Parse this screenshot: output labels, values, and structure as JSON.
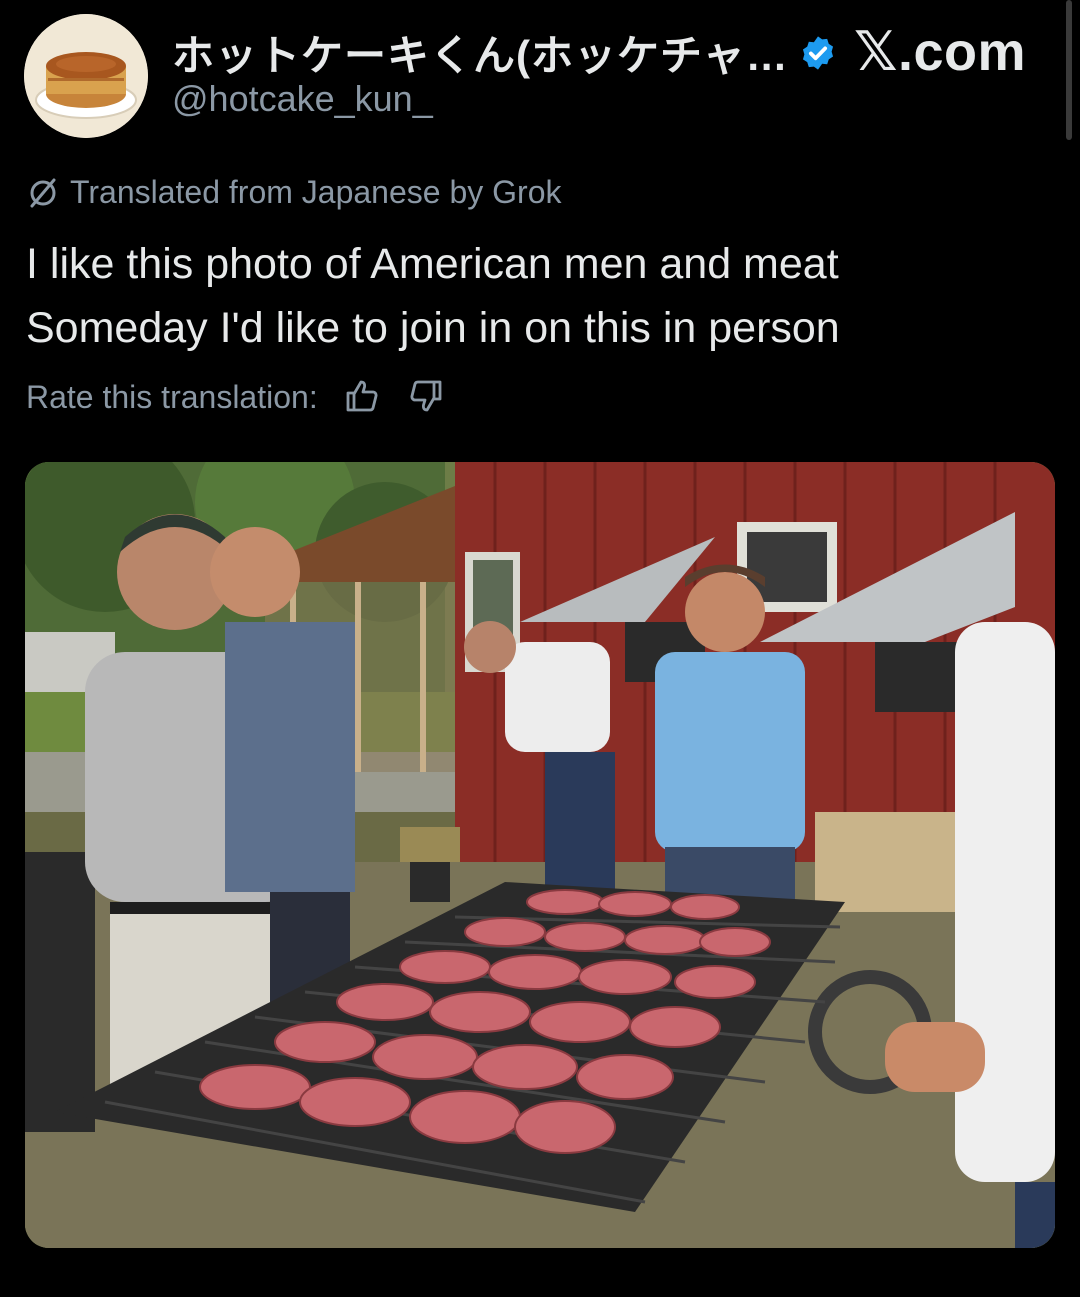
{
  "post": {
    "display_name": "ホットケーキくん(ホッケチャ…",
    "handle": "@hotcake_kun_",
    "site_label": "𝕏.com",
    "translation_note": "Translated from Japanese by Grok",
    "text": "I like this photo of American men and meat\nSomeday I'd like to join in on this in person",
    "rate_label": "Rate this translation:"
  },
  "icons": {
    "verified": "verified-badge-icon",
    "translate": "no-translation-icon",
    "like": "thumbs-up-icon",
    "dislike": "thumbs-down-icon"
  },
  "colors": {
    "background": "#000000",
    "text": "#e7e9ea",
    "secondary": "#8b98a5",
    "verified": "#1d9bf0"
  }
}
